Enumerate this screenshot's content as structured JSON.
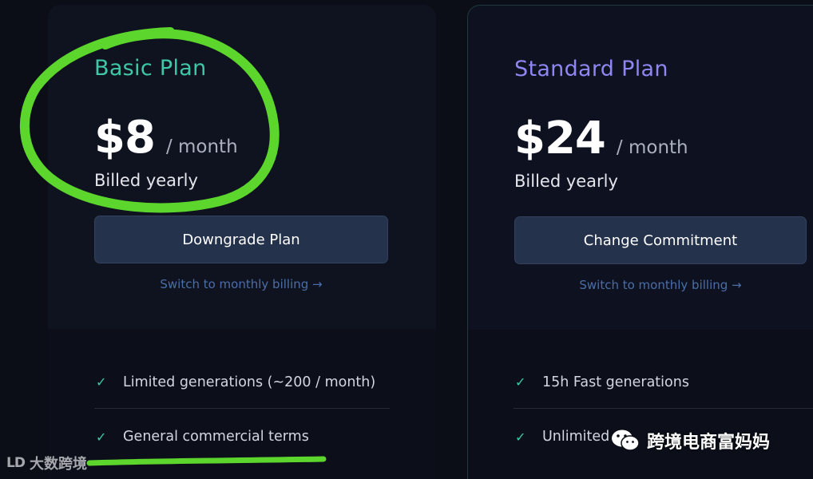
{
  "plans": [
    {
      "name": "Basic Plan",
      "price": "$8",
      "per": "/ month",
      "billing": "Billed yearly",
      "cta_label": "Downgrade Plan",
      "switch_label": "Switch to monthly billing →",
      "features": [
        "Limited generations (~200 / month)",
        "General commercial terms"
      ],
      "accent": "#3ec8a8"
    },
    {
      "name": "Standard Plan",
      "price": "$24",
      "per": "/ month",
      "billing": "Billed yearly",
      "cta_label": "Change Commitment",
      "switch_label": "Switch to monthly billing →",
      "features": [
        "15h Fast generations",
        "Unlimited"
      ],
      "accent": "#8f86f2"
    }
  ],
  "check_icon": "✓",
  "annotations": {
    "marker_color": "#5cd62c",
    "circle_target": "basic-plan-price",
    "underline_target": "general-commercial-terms"
  },
  "watermarks": {
    "left_logo_text": "LD",
    "left_text": "大数跨境",
    "right_text": "跨境电商富妈妈"
  },
  "colors": {
    "background": "#0b0e16",
    "button": "#25324c",
    "link": "#4b6ea6"
  }
}
